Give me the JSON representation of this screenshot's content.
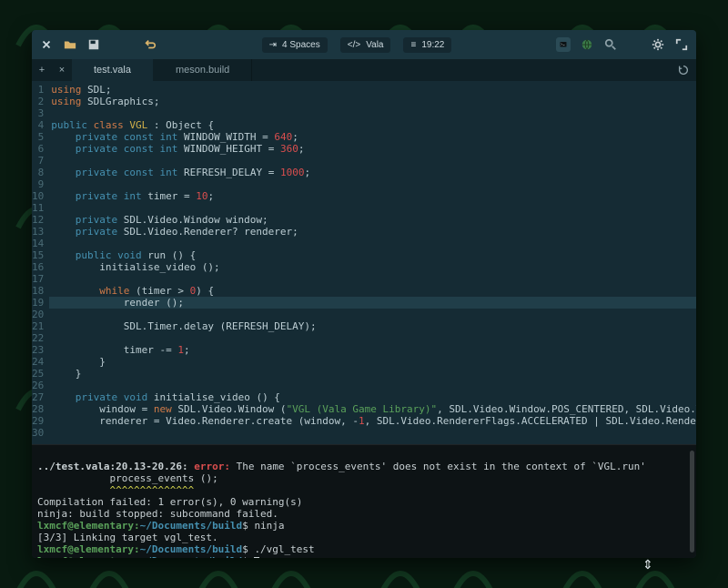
{
  "titlebar": {
    "indent": "4 Spaces",
    "language": "Vala",
    "position": "19:22"
  },
  "tabs": {
    "active": "test.vala",
    "inactive": "meson.build"
  },
  "code": {
    "lines": [
      {
        "n": 1,
        "seg": [
          [
            "kw",
            "using"
          ],
          [
            "op",
            " SDL;"
          ]
        ]
      },
      {
        "n": 2,
        "seg": [
          [
            "kw",
            "using"
          ],
          [
            "op",
            " SDLGraphics;"
          ]
        ]
      },
      {
        "n": 3,
        "seg": []
      },
      {
        "n": 4,
        "seg": [
          [
            "mod",
            "public"
          ],
          [
            "op",
            " "
          ],
          [
            "kw",
            "class"
          ],
          [
            "op",
            " "
          ],
          [
            "class",
            "VGL"
          ],
          [
            "op",
            " : Object {"
          ]
        ]
      },
      {
        "n": 5,
        "seg": [
          [
            "op",
            "    "
          ],
          [
            "mod",
            "private"
          ],
          [
            "op",
            " "
          ],
          [
            "mod",
            "const"
          ],
          [
            "op",
            " "
          ],
          [
            "mod",
            "int"
          ],
          [
            "op",
            " WINDOW_WIDTH = "
          ],
          [
            "num",
            "640"
          ],
          [
            "op",
            ";"
          ]
        ]
      },
      {
        "n": 6,
        "seg": [
          [
            "op",
            "    "
          ],
          [
            "mod",
            "private"
          ],
          [
            "op",
            " "
          ],
          [
            "mod",
            "const"
          ],
          [
            "op",
            " "
          ],
          [
            "mod",
            "int"
          ],
          [
            "op",
            " WINDOW_HEIGHT = "
          ],
          [
            "num",
            "360"
          ],
          [
            "op",
            ";"
          ]
        ]
      },
      {
        "n": 7,
        "seg": []
      },
      {
        "n": 8,
        "seg": [
          [
            "op",
            "    "
          ],
          [
            "mod",
            "private"
          ],
          [
            "op",
            " "
          ],
          [
            "mod",
            "const"
          ],
          [
            "op",
            " "
          ],
          [
            "mod",
            "int"
          ],
          [
            "op",
            " REFRESH_DELAY = "
          ],
          [
            "num",
            "1000"
          ],
          [
            "op",
            ";"
          ]
        ]
      },
      {
        "n": 9,
        "seg": []
      },
      {
        "n": 10,
        "seg": [
          [
            "op",
            "    "
          ],
          [
            "mod",
            "private"
          ],
          [
            "op",
            " "
          ],
          [
            "mod",
            "int"
          ],
          [
            "op",
            " timer = "
          ],
          [
            "num",
            "10"
          ],
          [
            "op",
            ";"
          ]
        ]
      },
      {
        "n": 11,
        "seg": []
      },
      {
        "n": 12,
        "seg": [
          [
            "op",
            "    "
          ],
          [
            "mod",
            "private"
          ],
          [
            "op",
            " SDL.Video.Window window;"
          ]
        ]
      },
      {
        "n": 13,
        "seg": [
          [
            "op",
            "    "
          ],
          [
            "mod",
            "private"
          ],
          [
            "op",
            " SDL.Video.Renderer? renderer;"
          ]
        ]
      },
      {
        "n": 14,
        "seg": []
      },
      {
        "n": 15,
        "seg": [
          [
            "op",
            "    "
          ],
          [
            "mod",
            "public"
          ],
          [
            "op",
            " "
          ],
          [
            "mod",
            "void"
          ],
          [
            "op",
            " run () {"
          ]
        ]
      },
      {
        "n": 16,
        "seg": [
          [
            "op",
            "        initialise_video ();"
          ]
        ]
      },
      {
        "n": 17,
        "seg": []
      },
      {
        "n": 18,
        "seg": [
          [
            "op",
            "        "
          ],
          [
            "kw",
            "while"
          ],
          [
            "op",
            " (timer > "
          ],
          [
            "num",
            "0"
          ],
          [
            "op",
            ") {"
          ]
        ]
      },
      {
        "n": 19,
        "seg": [
          [
            "op",
            "            render ();"
          ]
        ],
        "current": true
      },
      {
        "n": 20,
        "seg": []
      },
      {
        "n": 21,
        "seg": [
          [
            "op",
            "            SDL.Timer.delay (REFRESH_DELAY);"
          ]
        ]
      },
      {
        "n": 22,
        "seg": []
      },
      {
        "n": 23,
        "seg": [
          [
            "op",
            "            timer -= "
          ],
          [
            "num",
            "1"
          ],
          [
            "op",
            ";"
          ]
        ]
      },
      {
        "n": 24,
        "seg": [
          [
            "op",
            "        }"
          ]
        ]
      },
      {
        "n": 25,
        "seg": [
          [
            "op",
            "    }"
          ]
        ]
      },
      {
        "n": 26,
        "seg": []
      },
      {
        "n": 27,
        "seg": [
          [
            "op",
            "    "
          ],
          [
            "mod",
            "private"
          ],
          [
            "op",
            " "
          ],
          [
            "mod",
            "void"
          ],
          [
            "op",
            " initialise_video () {"
          ]
        ]
      },
      {
        "n": 28,
        "seg": [
          [
            "op",
            "        window = "
          ],
          [
            "kw",
            "new"
          ],
          [
            "op",
            " SDL.Video.Window ("
          ],
          [
            "str",
            "\"VGL (Vala Game Library)\""
          ],
          [
            "op",
            ", SDL.Video.Window.POS_CENTERED, SDL.Video.Window.POS_CENTERED, WINDOW_WIDTH, WINDOW_HEIGHT, SDL.Video.WindowFlags.SHOWN);"
          ]
        ]
      },
      {
        "n": 29,
        "seg": [
          [
            "op",
            "        renderer = Video.Renderer.create (window, -"
          ],
          [
            "num",
            "1"
          ],
          [
            "op",
            ", SDL.Video.RendererFlags.ACCELERATED | SDL.Video.RendererFlags.PRESENTVSYNC);"
          ]
        ]
      },
      {
        "n": 30,
        "seg": []
      }
    ]
  },
  "terminal": {
    "error_file": "../test.vala:20.13-20.26:",
    "error_label": "error:",
    "error_msg": "The name `process_events' does not exist in the context of `VGL.run'",
    "error_snippet": "            process_events ();",
    "error_carets": "            ^^^^^^^^^^^^^^",
    "compile_summary": "Compilation failed: 1 error(s), 0 warning(s)",
    "ninja_stop": "ninja: build stopped: subcommand failed.",
    "prompt_user": "lxmcf@elementary",
    "prompt_path": "~/Documents/build",
    "cmd1": "ninja",
    "link_line": "[3/3] Linking target vgl_test.",
    "cmd2": "./vgl_test"
  }
}
